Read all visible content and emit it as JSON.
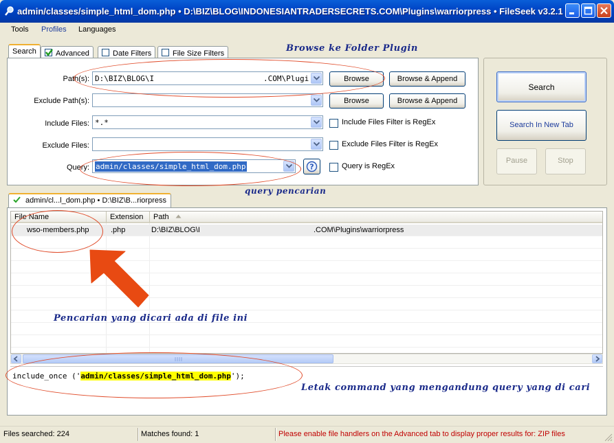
{
  "window": {
    "title": "admin/classes/simple_html_dom.php • D:\\BIZ\\BLOG\\INDONESIANTRADERSECRETS.COM\\Plugins\\warriorpress • FileSeek v3.2.1"
  },
  "menu": [
    "Tools",
    "Profiles",
    "Languages"
  ],
  "tabs": [
    {
      "label": "Search",
      "checkbox": "none"
    },
    {
      "label": "Advanced",
      "checkbox": "checked"
    },
    {
      "label": "Date Filters",
      "checkbox": "unchecked"
    },
    {
      "label": "File Size Filters",
      "checkbox": "unchecked"
    }
  ],
  "form": {
    "paths": {
      "label": "Path(s):",
      "value": "D:\\BIZ\\BLOG\\I",
      "value_tail": ".COM\\Plugi"
    },
    "exclude_paths": {
      "label": "Exclude Path(s):",
      "value": ""
    },
    "include_files": {
      "label": "Include Files:",
      "value": "*.*",
      "regex_label": "Include Files Filter is RegEx"
    },
    "exclude_files": {
      "label": "Exclude Files:",
      "value": "",
      "regex_label": "Exclude Files Filter is RegEx"
    },
    "query": {
      "label": "Query:",
      "value": "admin/classes/simple_html_dom.php",
      "regex_label": "Query is RegEx"
    },
    "browse_label": "Browse",
    "browse_append_label": "Browse & Append"
  },
  "actions": {
    "search": "Search",
    "search_new_tab": "Search In New Tab",
    "pause": "Pause",
    "stop": "Stop"
  },
  "results_tab": {
    "label": "admin/cl...l_dom.php • D:\\BIZ\\B...riorpress"
  },
  "results": {
    "columns": [
      "File Name",
      "Extension",
      "Path"
    ],
    "rows": [
      {
        "file": "wso-members.php",
        "ext": ".php",
        "path": "D:\\BIZ\\BLOG\\I",
        "path_tail": ".COM\\Plugins\\warriorpress"
      }
    ]
  },
  "code": {
    "prefix": "include_once ('",
    "match": "admin/classes/simple_html_dom.php",
    "suffix": "');"
  },
  "status": {
    "files_searched": "Files searched: 224",
    "matches_found": "Matches found: 1",
    "warning": "Please enable file handlers on the Advanced tab to display proper results for: ZIP files"
  },
  "annotations": {
    "browse": "Browse ke Folder Plugin",
    "query": "query pencarian",
    "found": "Pencarian yang dicari ada di file ini",
    "command": "Letak command yang mengandung query yang di cari"
  },
  "colors": {
    "accent": "#0046c6",
    "annotation_text": "#1a2a8a",
    "annotation_ellipse": "#e04a28",
    "arrow": "#e84a12",
    "warning_text": "#c00000",
    "highlight": "#ffff00"
  }
}
